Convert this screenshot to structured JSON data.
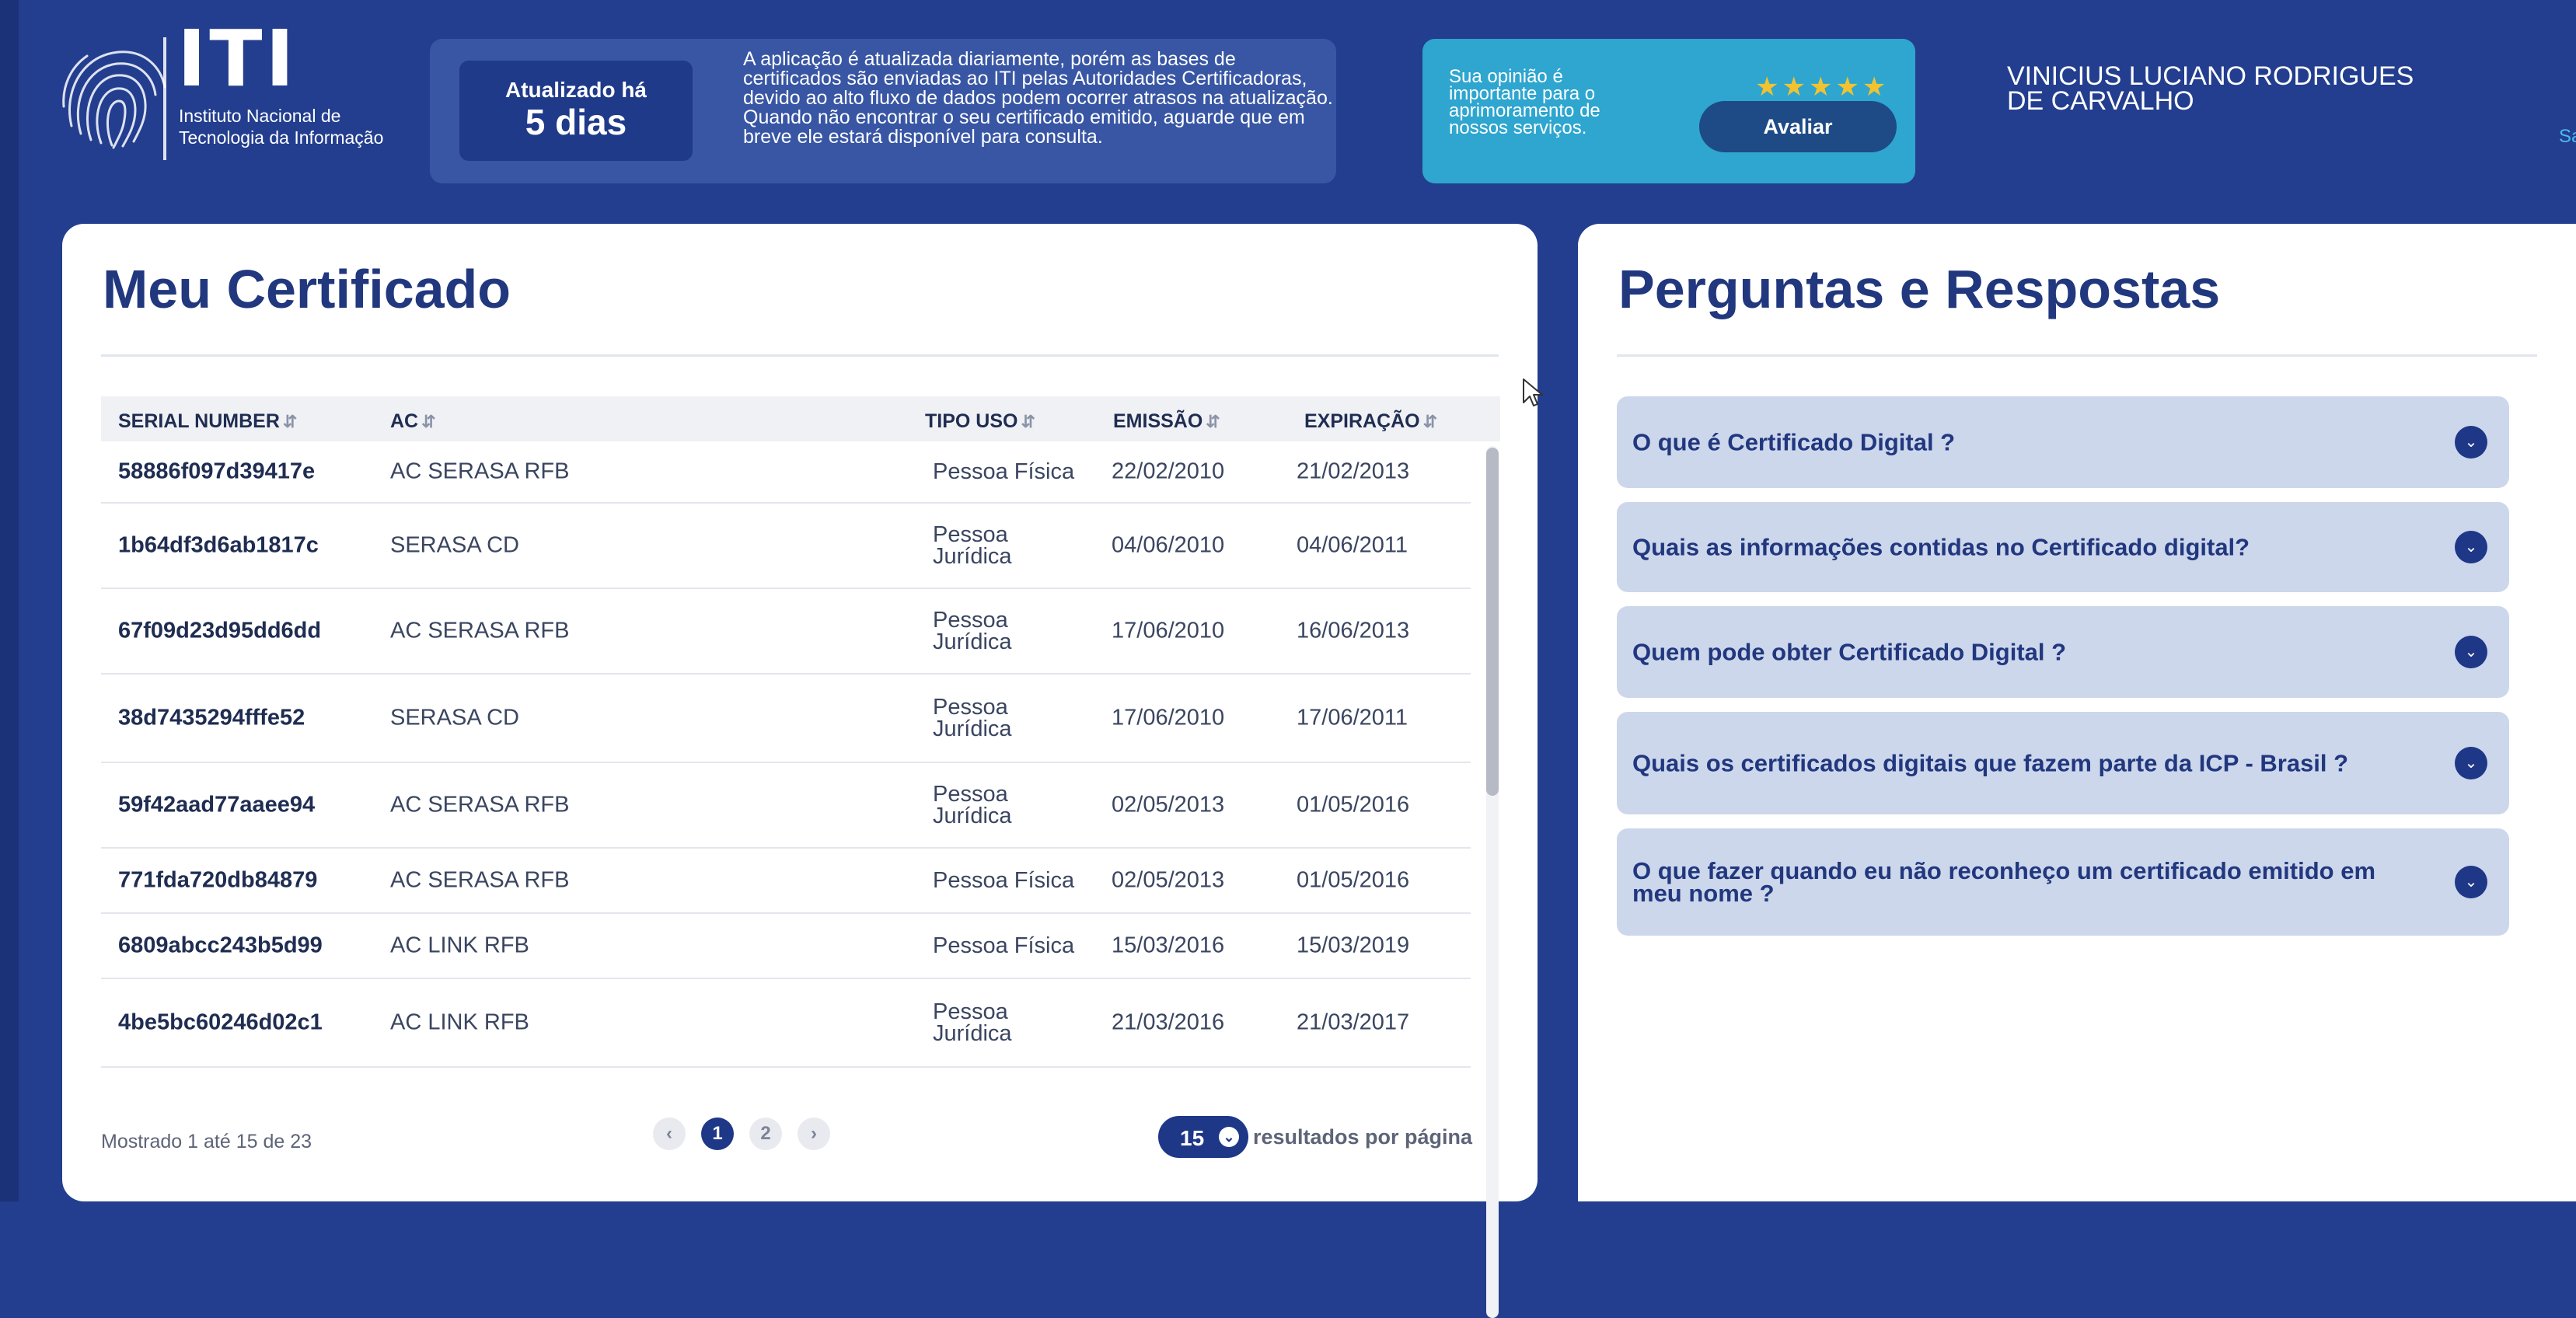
{
  "brand": {
    "logo_text": "ITI",
    "subtitle_line1": "Instituto Nacional de",
    "subtitle_line2": "Tecnologia da Informação"
  },
  "update_notice": {
    "label": "Atualizado há",
    "value": "5 dias",
    "message": "A aplicação é atualizada diariamente, porém as bases de certificados são enviadas ao ITI pelas Autoridades Certificadoras, devido ao alto fluxo de dados podem ocorrer atrasos na atualização. Quando não encontrar o seu certificado emitido, aguarde que em breve ele estará disponível para consulta."
  },
  "rating": {
    "text": "Sua opinião é importante para o aprimoramento de nossos serviços.",
    "stars": "★★★★★",
    "button_label": "Avaliar"
  },
  "user": {
    "name": "VINICIUS LUCIANO RODRIGUES DE CARVALHO",
    "logout_label": "Sair"
  },
  "certificates": {
    "title": "Meu Certificado",
    "columns": [
      "SERIAL NUMBER",
      "AC",
      "TIPO USO",
      "EMISSÃO",
      "EXPIRAÇÃO"
    ],
    "rows": [
      {
        "serial": "58886f097d39417e",
        "ac": "AC SERASA RFB",
        "tipo": "Pessoa Física",
        "emissao": "22/02/2010",
        "expiracao": "21/02/2013"
      },
      {
        "serial": "1b64df3d6ab1817c",
        "ac": "SERASA CD",
        "tipo": "Pessoa Jurídica",
        "emissao": "04/06/2010",
        "expiracao": "04/06/2011"
      },
      {
        "serial": "67f09d23d95dd6dd",
        "ac": "AC SERASA RFB",
        "tipo": "Pessoa Jurídica",
        "emissao": "17/06/2010",
        "expiracao": "16/06/2013"
      },
      {
        "serial": "38d7435294fffe52",
        "ac": "SERASA CD",
        "tipo": "Pessoa Jurídica",
        "emissao": "17/06/2010",
        "expiracao": "17/06/2011"
      },
      {
        "serial": "59f42aad77aaee94",
        "ac": "AC SERASA RFB",
        "tipo": "Pessoa Jurídica",
        "emissao": "02/05/2013",
        "expiracao": "01/05/2016"
      },
      {
        "serial": "771fda720db84879",
        "ac": "AC SERASA RFB",
        "tipo": "Pessoa Física",
        "emissao": "02/05/2013",
        "expiracao": "01/05/2016"
      },
      {
        "serial": "6809abcc243b5d99",
        "ac": "AC LINK RFB",
        "tipo": "Pessoa Física",
        "emissao": "15/03/2016",
        "expiracao": "15/03/2019"
      },
      {
        "serial": "4be5bc60246d02c1",
        "ac": "AC LINK RFB",
        "tipo": "Pessoa Jurídica",
        "emissao": "21/03/2016",
        "expiracao": "21/03/2017"
      }
    ],
    "footer_info": "Mostrado 1 até 15 de 23",
    "pagination": {
      "prev": "‹",
      "pages": [
        "1",
        "2"
      ],
      "next": "›"
    },
    "per_page_value": "15",
    "per_page_label": "resultados por página"
  },
  "faq": {
    "title": "Perguntas e Respostas",
    "items": [
      {
        "question": "O que é Certificado Digital ?"
      },
      {
        "question": "Quais as informações contidas no Certificado digital?"
      },
      {
        "question": "Quem pode obter Certificado Digital ?"
      },
      {
        "question": "Quais os certificados digitais que fazem parte da ICP - Brasil ?"
      },
      {
        "question": "O que fazer quando eu não reconheço um certificado emitido em meu nome ?"
      }
    ]
  },
  "icons": {
    "sort": "sort-icon",
    "chevron": "chevron-down-icon",
    "logo": "fingerprint-icon"
  },
  "colors": {
    "background": "#233e8f",
    "primary": "#1e3787",
    "accent": "#2ea6cf",
    "faq_bg": "#cdd7ec"
  }
}
